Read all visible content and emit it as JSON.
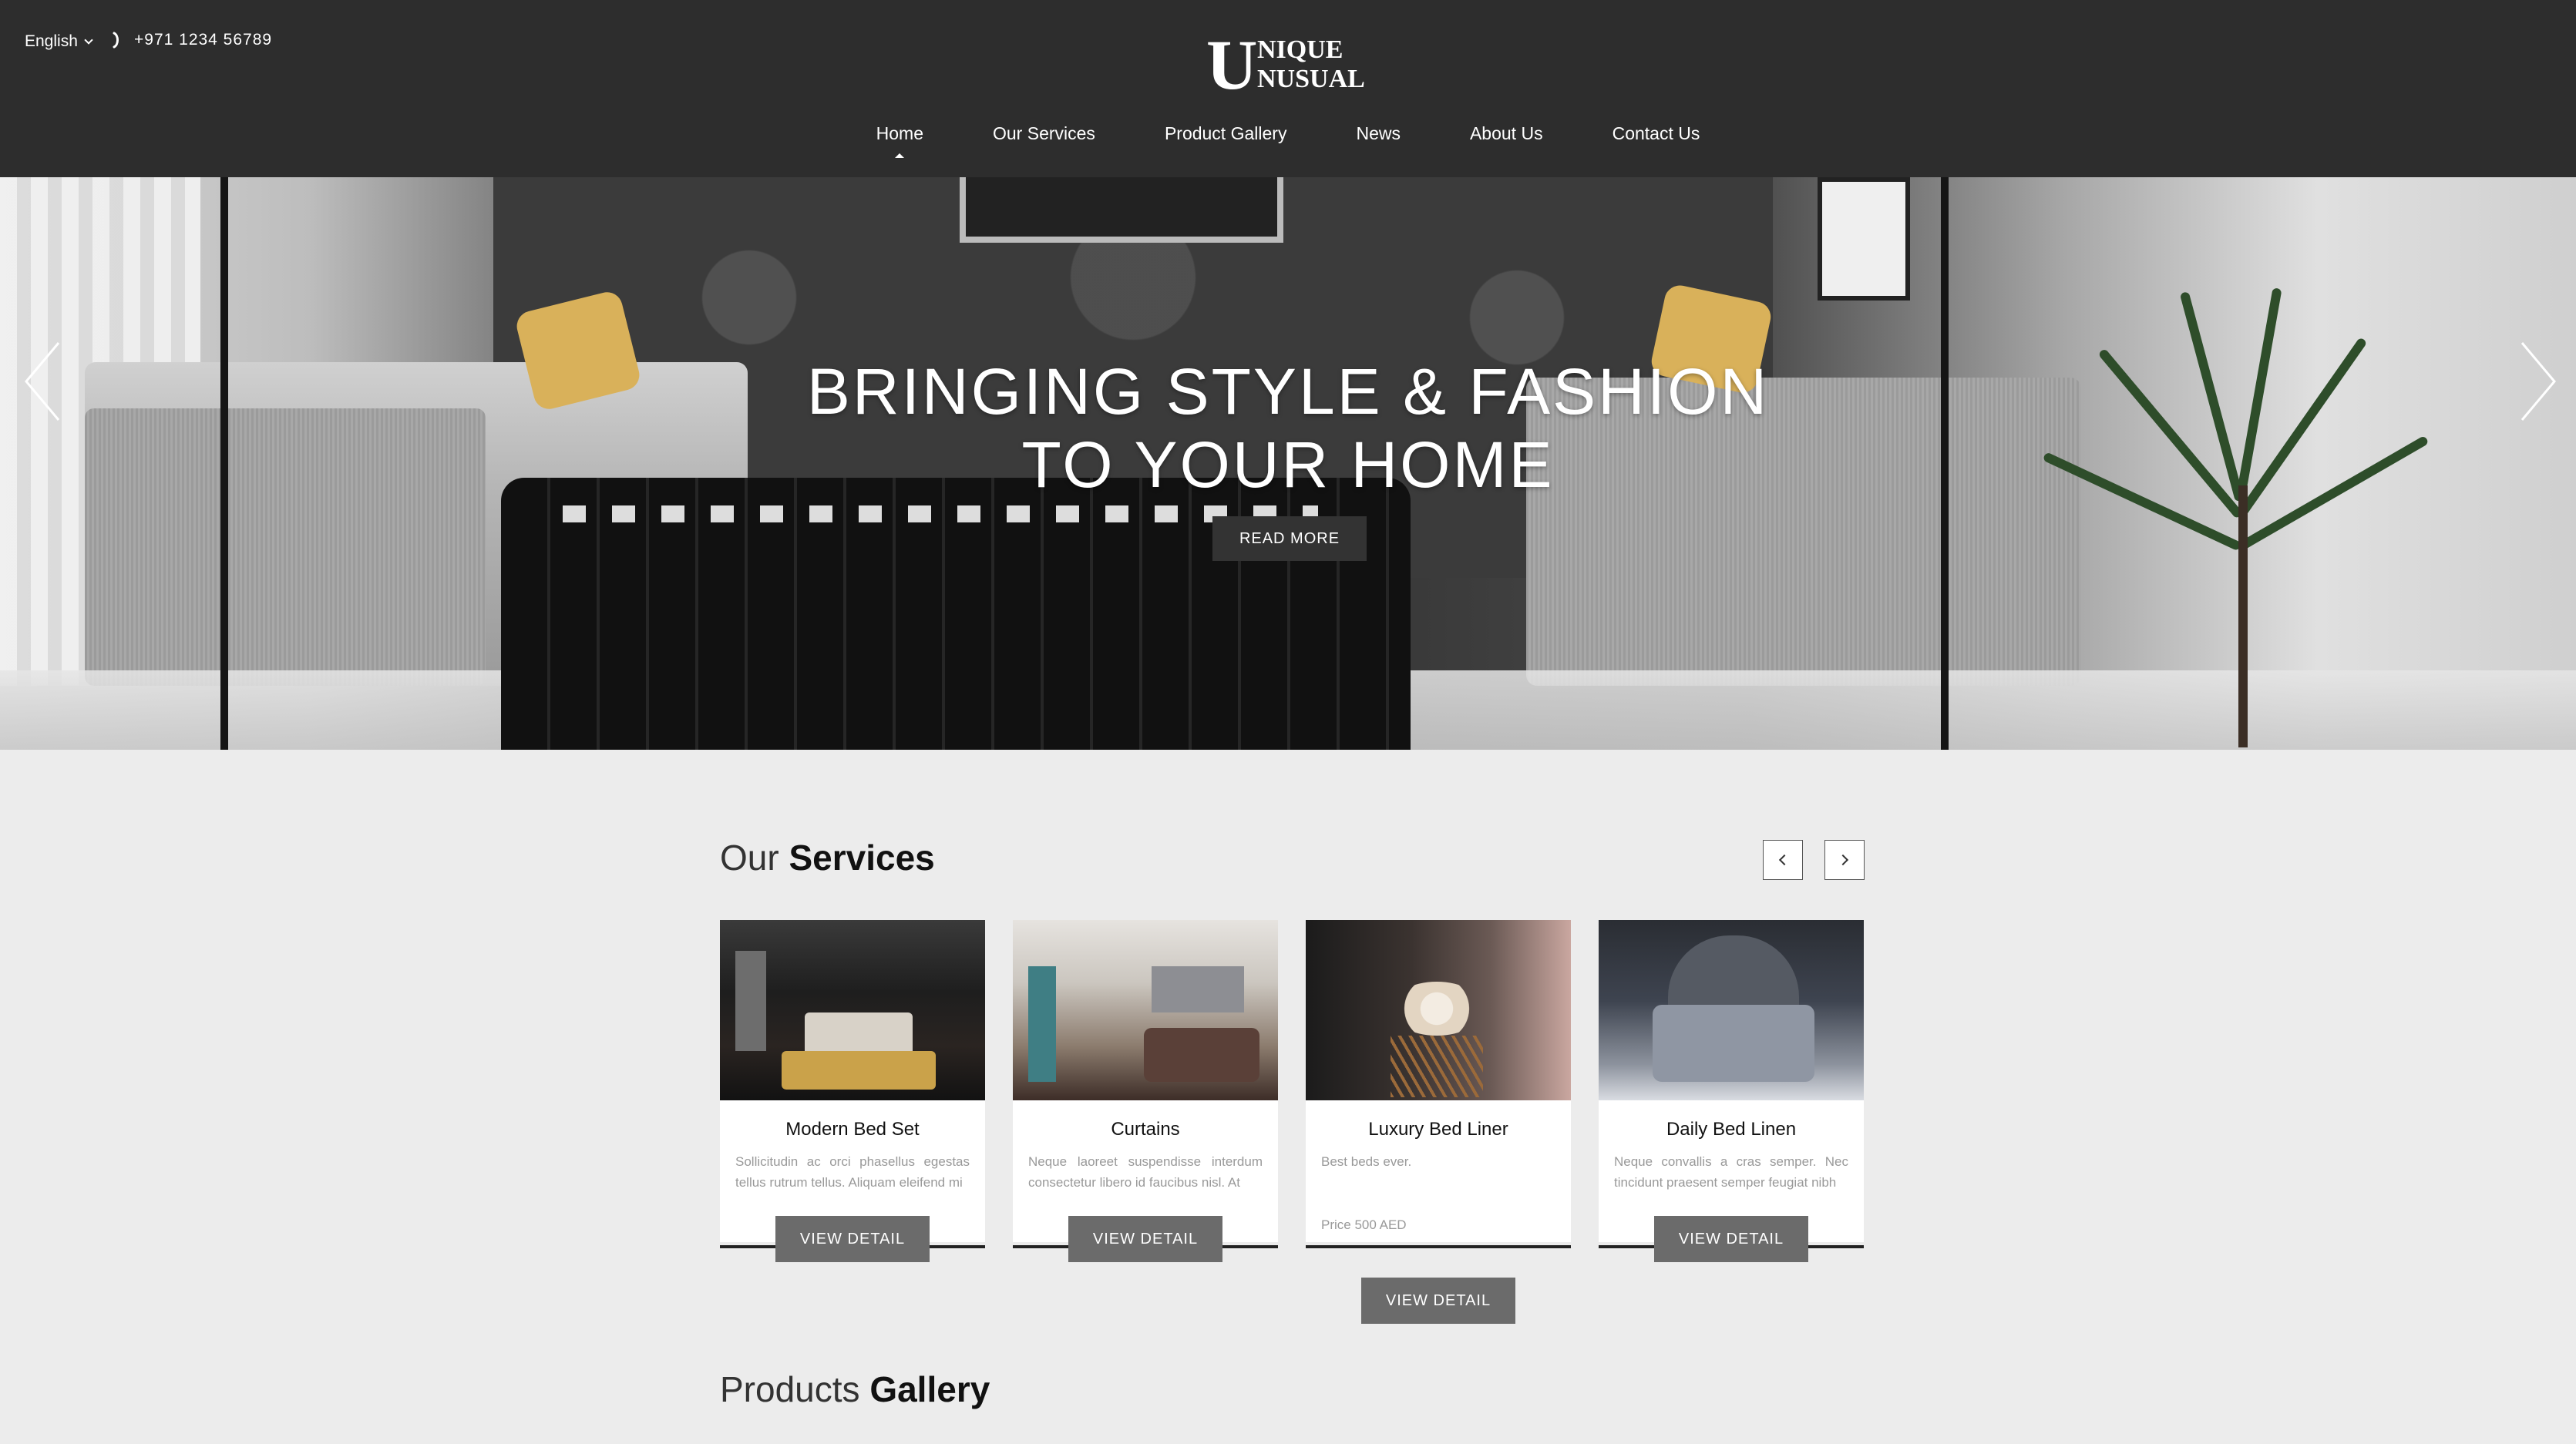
{
  "header": {
    "language": "English",
    "phone": "+971 1234 56789",
    "logo": {
      "initial": "U",
      "line1": "NIQUE",
      "line2": "NUSUAL"
    },
    "nav": [
      "Home",
      "Our Services",
      "Product Gallery",
      "News",
      "About Us",
      "Contact Us"
    ],
    "active_nav": "Home"
  },
  "hero": {
    "line1": "BRINGING STYLE & FASHION",
    "line2": "TO YOUR HOME",
    "button": "READ MORE"
  },
  "services": {
    "title_light": "Our",
    "title_bold": "Services",
    "cards": [
      {
        "name": "Modern Bed Set",
        "desc": "Sollicitudin ac orci phasellus egestas tellus rutrum tellus. Aliquam eleifend mi",
        "price": "",
        "button": "VIEW DETAIL"
      },
      {
        "name": "Curtains",
        "desc": "Neque laoreet suspendisse interdum consectetur libero id faucibus nisl. At",
        "price": "",
        "button": "VIEW DETAIL"
      },
      {
        "name": "Luxury Bed Liner",
        "desc": "Best beds ever.",
        "price": "Price 500 AED",
        "button": "VIEW DETAIL"
      },
      {
        "name": "Daily Bed Linen",
        "desc": "Neque convallis a cras semper. Nec tincidunt praesent semper feugiat nibh",
        "price": "",
        "button": "VIEW DETAIL"
      }
    ]
  },
  "products": {
    "title_light": "Products",
    "title_bold": "Gallery"
  },
  "colors": {
    "header_bg": "#2d2d2d",
    "page_bg": "#ececec",
    "button_grey": "#6b6b6b"
  }
}
